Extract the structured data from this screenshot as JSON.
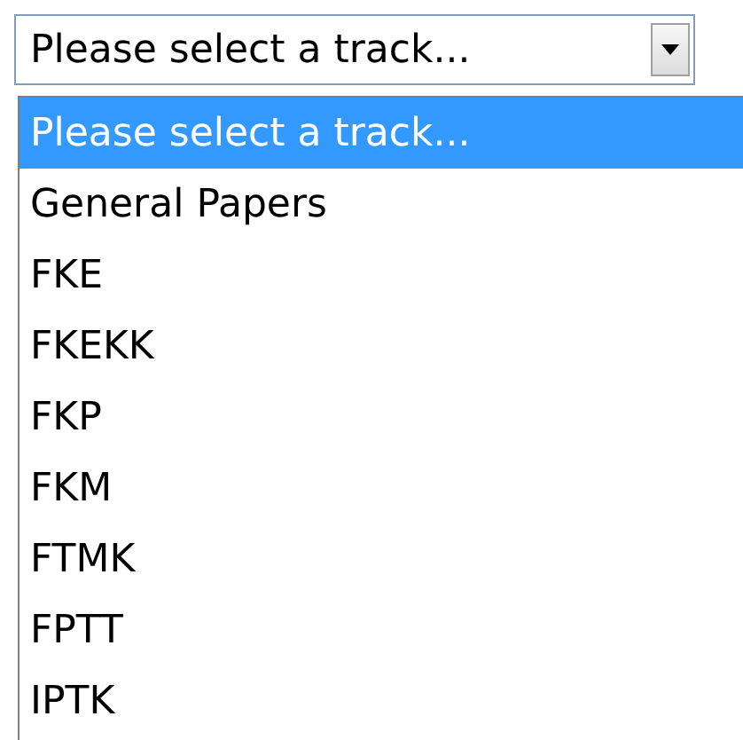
{
  "select": {
    "value": "Please select a track..."
  },
  "options": [
    {
      "label": "Please select a track...",
      "selected": true
    },
    {
      "label": "General Papers",
      "selected": false
    },
    {
      "label": "FKE",
      "selected": false
    },
    {
      "label": "FKEKK",
      "selected": false
    },
    {
      "label": "FKP",
      "selected": false
    },
    {
      "label": "FKM",
      "selected": false
    },
    {
      "label": "FTMK",
      "selected": false
    },
    {
      "label": "FPTT",
      "selected": false
    },
    {
      "label": "IPTK",
      "selected": false
    }
  ]
}
